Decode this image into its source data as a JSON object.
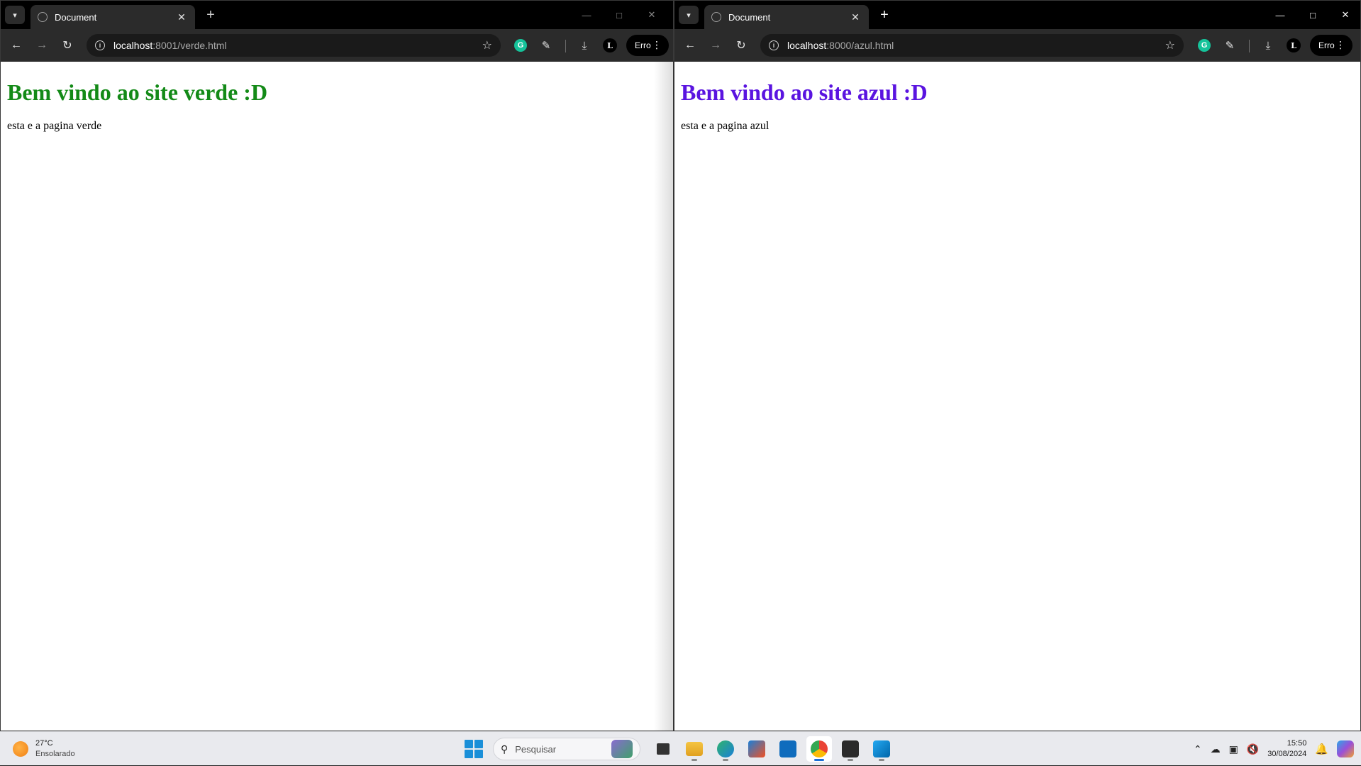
{
  "left_window": {
    "tab_title": "Document",
    "url_host": "localhost",
    "url_path": ":8001/verde.html",
    "profile_letter": "L",
    "error_label": "Erro",
    "page": {
      "heading": "Bem vindo ao site verde :D",
      "heading_color": "#138a17",
      "paragraph": "esta e a pagina verde"
    }
  },
  "right_window": {
    "tab_title": "Document",
    "url_host": "localhost",
    "url_path": ":8000/azul.html",
    "profile_letter": "L",
    "error_label": "Erro",
    "page": {
      "heading": "Bem vindo ao site azul :D",
      "heading_color": "#5a14e0",
      "paragraph": "esta e a pagina azul"
    }
  },
  "taskbar": {
    "weather_temp": "27°C",
    "weather_desc": "Ensolarado",
    "search_placeholder": "Pesquisar",
    "clock_time": "15:50",
    "clock_date": "30/08/2024",
    "grammarly_letter": "G"
  },
  "icons": [
    "tab-list-icon",
    "globe-icon",
    "close-icon",
    "plus-icon",
    "minimize-icon",
    "maximize-icon",
    "back-arrow-icon",
    "forward-arrow-icon",
    "reload-icon",
    "info-icon",
    "star-icon",
    "grammarly-icon",
    "extensions-icon",
    "download-icon",
    "menu-dots-icon",
    "windows-start-icon",
    "search-icon",
    "file-explorer-icon",
    "edge-icon",
    "store-icon",
    "outlook-icon",
    "chrome-icon",
    "terminal-icon",
    "vscode-icon",
    "chevron-up-icon",
    "cloud-off-icon",
    "network-icon",
    "volume-mute-icon",
    "bell-icon",
    "copilot-icon"
  ]
}
